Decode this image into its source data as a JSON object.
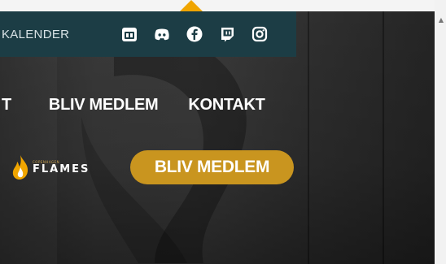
{
  "topbar": {
    "calendar_label": "KALENDER",
    "social_icons": [
      "calendar-icon",
      "discord-icon",
      "facebook-icon",
      "twitch-icon",
      "instagram-icon"
    ]
  },
  "nav": {
    "items": [
      {
        "label": "T"
      },
      {
        "label": "BLIV MEDLEM"
      },
      {
        "label": "KONTAKT"
      }
    ]
  },
  "logo": {
    "small_text": "COPENHAGEN",
    "big_text": "FLAMES"
  },
  "cta": {
    "label": "BLIV MEDLEM"
  },
  "colors": {
    "topbar_bg": "#1c3d45",
    "cta_bg": "#c9951f",
    "flame_orange": "#f0a500"
  }
}
